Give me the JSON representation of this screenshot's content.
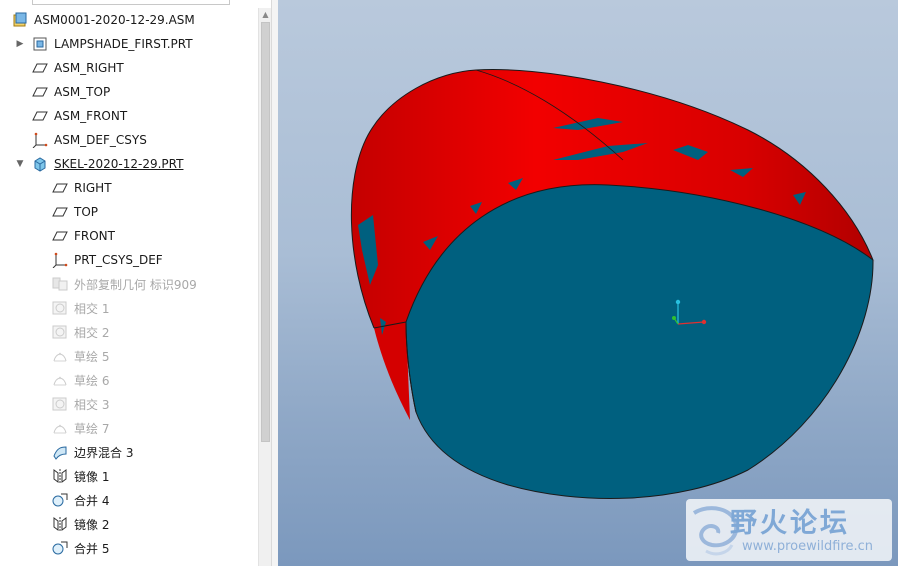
{
  "model_tree": {
    "items": [
      {
        "label": "ASM0001-2020-12-29.ASM",
        "icon": "assembly-icon",
        "state": "normal",
        "expander": ""
      },
      {
        "label": "LAMPSHADE_FIRST.PRT",
        "icon": "part-icon",
        "state": "normal",
        "expander": "collapsed"
      },
      {
        "label": "ASM_RIGHT",
        "icon": "datum-plane-icon",
        "state": "normal",
        "expander": ""
      },
      {
        "label": "ASM_TOP",
        "icon": "datum-plane-icon",
        "state": "normal",
        "expander": ""
      },
      {
        "label": "ASM_FRONT",
        "icon": "datum-plane-icon",
        "state": "normal",
        "expander": ""
      },
      {
        "label": "ASM_DEF_CSYS",
        "icon": "csys-icon",
        "state": "normal",
        "expander": ""
      },
      {
        "label": "SKEL-2020-12-29.PRT",
        "icon": "skeleton-part-icon",
        "state": "normal",
        "expander": "expanded"
      },
      {
        "label": "RIGHT",
        "icon": "datum-plane-icon",
        "state": "normal",
        "expander": ""
      },
      {
        "label": "TOP",
        "icon": "datum-plane-icon",
        "state": "normal",
        "expander": ""
      },
      {
        "label": "FRONT",
        "icon": "datum-plane-icon",
        "state": "normal",
        "expander": ""
      },
      {
        "label": "PRT_CSYS_DEF",
        "icon": "csys-icon",
        "state": "normal",
        "expander": ""
      },
      {
        "label": "外部复制几何 标识909",
        "icon": "external-copy-geom-icon",
        "state": "suppressed",
        "expander": ""
      },
      {
        "label": "相交 1",
        "icon": "intersect-icon",
        "state": "suppressed",
        "expander": ""
      },
      {
        "label": "相交 2",
        "icon": "intersect-icon",
        "state": "suppressed",
        "expander": ""
      },
      {
        "label": "草绘 5",
        "icon": "sketch-icon",
        "state": "suppressed",
        "expander": ""
      },
      {
        "label": "草绘 6",
        "icon": "sketch-icon",
        "state": "suppressed",
        "expander": ""
      },
      {
        "label": "相交 3",
        "icon": "intersect-icon",
        "state": "suppressed",
        "expander": ""
      },
      {
        "label": "草绘 7",
        "icon": "sketch-icon",
        "state": "suppressed",
        "expander": ""
      },
      {
        "label": "边界混合 3",
        "icon": "boundary-blend-icon",
        "state": "normal",
        "expander": ""
      },
      {
        "label": "镜像 1",
        "icon": "mirror-icon",
        "state": "normal",
        "expander": ""
      },
      {
        "label": "合并 4",
        "icon": "merge-icon",
        "state": "normal",
        "expander": ""
      },
      {
        "label": "镜像 2",
        "icon": "mirror-icon",
        "state": "normal",
        "expander": ""
      },
      {
        "label": "合并 5",
        "icon": "merge-icon",
        "state": "normal",
        "expander": ""
      }
    ]
  },
  "viewport": {
    "model_colors": {
      "outer_surface": "#e80000",
      "inner_surface": "#00607f",
      "edge": "#1a1a1a"
    },
    "csys_colors": {
      "x_axis": "#e03030",
      "y_axis": "#28c0e0",
      "z_axis": "#30c030"
    }
  },
  "watermark": {
    "title": "野火论坛",
    "url": "www.proewildfire.cn"
  },
  "colors": {
    "suppressed_text": "#a8a8a8",
    "normal_text": "#1a1a1a"
  }
}
